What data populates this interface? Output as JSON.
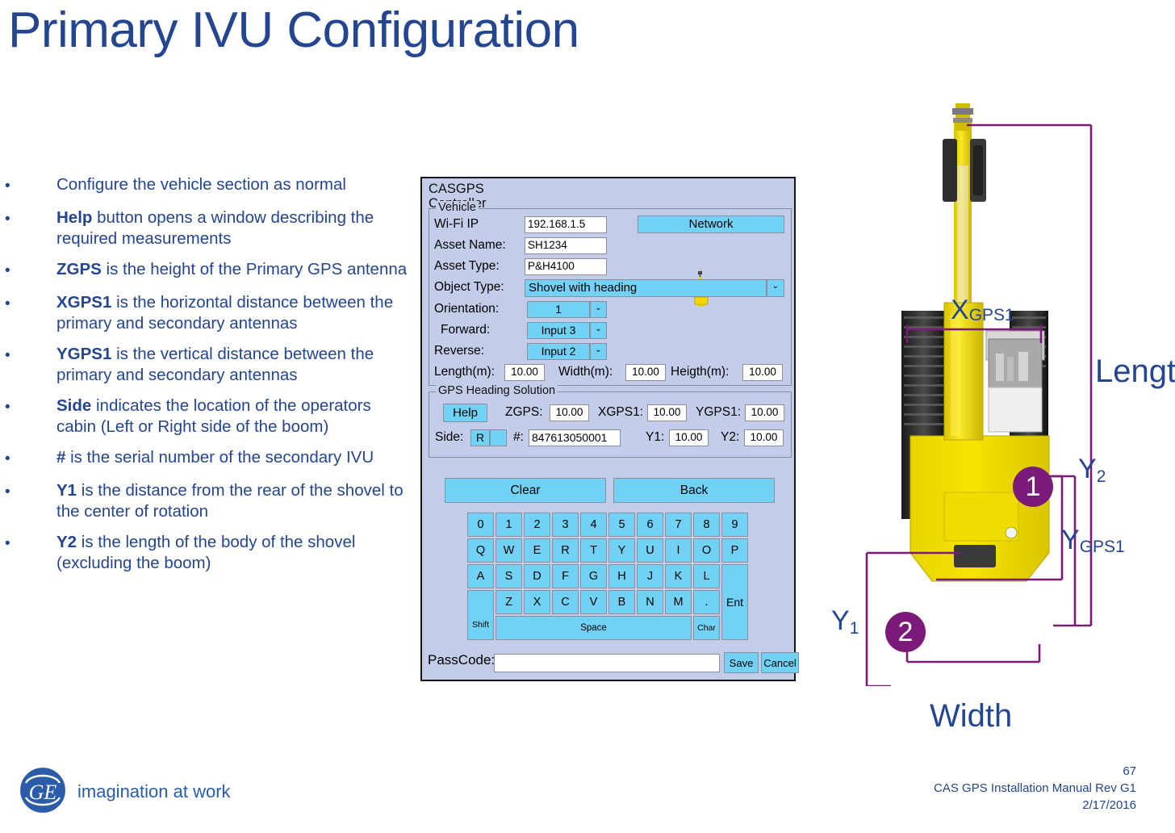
{
  "slide": {
    "title": "Primary IVU Configuration"
  },
  "bullets": [
    {
      "marker": "•",
      "html": "Configure the vehicle section as normal"
    },
    {
      "marker": "•",
      "bold": "Help",
      "rest": " button opens a window describing the required measurements"
    },
    {
      "marker": "•",
      "bold": "ZGPS",
      "rest": " is the height of the Primary GPS antenna"
    },
    {
      "marker": "•",
      "bold": "XGPS1",
      "rest": " is the horizontal distance between the primary and secondary antennas"
    },
    {
      "marker": "•",
      "bold": "YGPS1",
      "rest": " is the vertical distance between the primary and secondary antennas"
    },
    {
      "marker": "•",
      "bold": "Side",
      "rest": " indicates the location of the operators cabin (Left or Right side of the boom)"
    },
    {
      "marker": "•",
      "bold": "#",
      "rest": " is the serial number of the secondary IVU"
    },
    {
      "marker": "•",
      "bold": "Y1",
      "rest": " is the distance from the rear of the shovel to the center of rotation"
    },
    {
      "marker": "•",
      "bold": "Y2",
      "rest": " is the length of the body of the shovel (excluding the boom)"
    }
  ],
  "dialog": {
    "title": "CASGPS\nController",
    "vehicle_group": {
      "legend": "Vehicle",
      "wifi_ip_label": "Wi-Fi IP",
      "wifi_ip_value": "192.168.1.5",
      "network_button": "Network",
      "asset_name_label": "Asset Name:",
      "asset_name_value": "SH1234",
      "asset_type_label": "Asset Type:",
      "asset_type_value": "P&H4100",
      "object_type_label": "Object Type:",
      "object_type_value": "Shovel with heading",
      "orientation_label": "Orientation:",
      "orientation_value": "1",
      "forward_label": "Forward:",
      "forward_value": "Input 3",
      "reverse_label": "Reverse:",
      "reverse_value": "Input 2",
      "length_label": "Length(m):",
      "length_value": "10.00",
      "width_label": "Width(m):",
      "width_value": "10.00",
      "height_label": "Heigth(m):",
      "height_value": "10.00",
      "dropdown_glyph": "⌄"
    },
    "gps_group": {
      "legend": "GPS Heading Solution",
      "help_button": "Help",
      "zgps_label": "ZGPS:",
      "zgps_value": "10.00",
      "xgps1_label": "XGPS1:",
      "xgps1_value": "10.00",
      "ygps1_label": "YGPS1:",
      "ygps1_value": "10.00",
      "side_label": "Side:",
      "side_value": "R",
      "serial_label": "#:",
      "serial_value": "847613050001",
      "y1_label": "Y1:",
      "y1_value": "10.00",
      "y2_label": "Y2:",
      "y2_value": "10.00"
    },
    "clear_button": "Clear",
    "back_button": "Back",
    "keyboard": {
      "row_digits": [
        "0",
        "1",
        "2",
        "3",
        "4",
        "5",
        "6",
        "7",
        "8",
        "9"
      ],
      "row_top": [
        "Q",
        "W",
        "E",
        "R",
        "T",
        "Y",
        "U",
        "I",
        "O",
        "P"
      ],
      "row_home": [
        "A",
        "S",
        "D",
        "F",
        "G",
        "H",
        "J",
        "K",
        "L"
      ],
      "row_bottom": [
        "Z",
        "X",
        "C",
        "V",
        "B",
        "N",
        "M",
        "."
      ],
      "shift": "Shift",
      "space": "Space",
      "char": "Char",
      "enter": "Ent"
    },
    "passcode_label": "PassCode:",
    "passcode_value": "",
    "passcode_placeholder": "",
    "save_button": "Save",
    "cancel_button": "Cancel"
  },
  "diagram": {
    "labels": {
      "xgps1_main": "X",
      "xgps1_sub": "GPS1",
      "ygps1_main": "Y",
      "ygps1_sub": "GPS1",
      "y1_main": "Y",
      "y1_sub": "1",
      "y2_main": "Y",
      "y2_sub": "2",
      "length": "Lengt",
      "width": "Width"
    },
    "badges": [
      "1",
      "2"
    ],
    "colors": {
      "dimension_line": "#7b1a78",
      "label_text": "#24458f",
      "badge_fill": "#7b1a78",
      "machine_body": "#f2d800"
    }
  },
  "footer": {
    "tagline": "imagination at work",
    "page_number": "67",
    "doc_title": "CAS GPS Installation Manual Rev G1",
    "doc_date": "2/17/2016"
  },
  "theme": {
    "title_blue": "#24458f",
    "dialog_bg": "#c3cdea",
    "control_cyan": "#72d2f5",
    "purple": "#7b1a78"
  }
}
